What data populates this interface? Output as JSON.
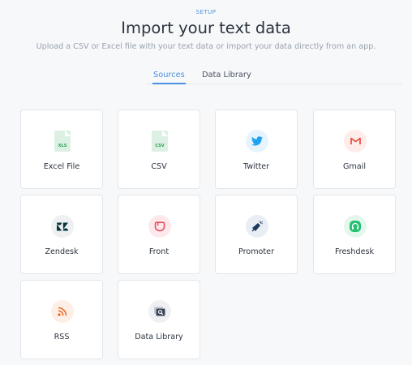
{
  "header": {
    "eyebrow": "SETUP",
    "title": "Import your text data",
    "subtitle": "Upload a CSV or Excel file with your text data or import your data directly from an app."
  },
  "tabs": [
    {
      "label": "Sources",
      "active": true
    },
    {
      "label": "Data Library",
      "active": false
    }
  ],
  "sources": [
    {
      "label": "Excel File",
      "icon": "xls-file-icon",
      "icon_text": "XLS"
    },
    {
      "label": "CSV",
      "icon": "csv-file-icon",
      "icon_text": "CSV"
    },
    {
      "label": "Twitter",
      "icon": "twitter-icon"
    },
    {
      "label": "Gmail",
      "icon": "gmail-icon"
    },
    {
      "label": "Zendesk",
      "icon": "zendesk-icon"
    },
    {
      "label": "Front",
      "icon": "front-icon"
    },
    {
      "label": "Promoter",
      "icon": "promoter-icon"
    },
    {
      "label": "Freshdesk",
      "icon": "freshdesk-icon"
    },
    {
      "label": "RSS",
      "icon": "rss-icon"
    },
    {
      "label": "Data Library",
      "icon": "data-library-icon"
    }
  ],
  "colors": {
    "accent": "#4a90e2",
    "excel": "#2f9e5a",
    "twitter": "#1da1f2",
    "gmail": "#ea4335",
    "front": "#e84a5f",
    "freshdesk": "#25c16f",
    "rss": "#f26522"
  }
}
